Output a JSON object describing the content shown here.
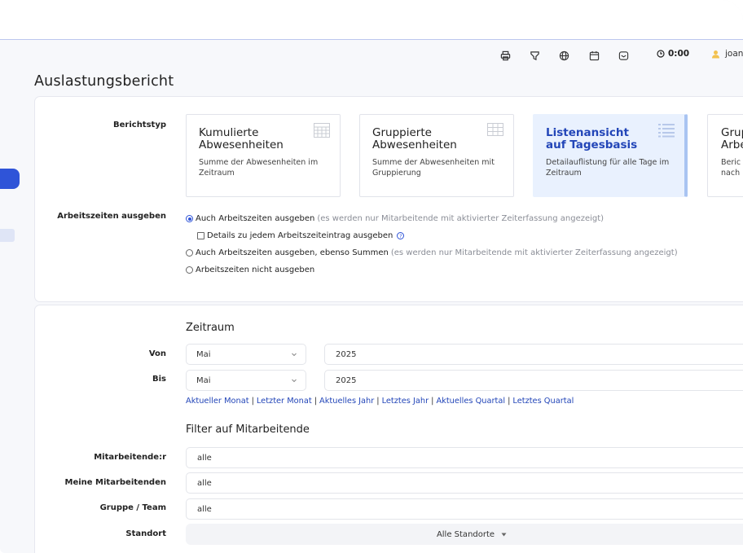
{
  "toolbar": {
    "icons": [
      "print-icon",
      "funnel-icon",
      "globe-icon",
      "calendar-icon",
      "inbox-icon"
    ],
    "clock_label": "0:00",
    "user_name": "joan"
  },
  "page_title": "Auslastungsbericht",
  "report_type": {
    "label": "Berichtstyp",
    "tiles": [
      {
        "title": "Kumulierte Abwesenheiten",
        "desc": "Summe der Abwesenheiten im Zeitraum",
        "icon": "calculator-icon",
        "active": false
      },
      {
        "title": "Gruppierte Abwesenheiten",
        "desc": "Summe der Abwesenheiten mit Gruppierung",
        "icon": "table-icon",
        "active": false
      },
      {
        "title": "Listenansicht auf Tagesbasis",
        "desc": "Detailauflistung für alle Tage im Zeitraum",
        "icon": "list-icon",
        "active": true
      },
      {
        "title": "Grup Arbe",
        "desc": "Beric nach",
        "icon": "",
        "active": false
      }
    ]
  },
  "worktime": {
    "label": "Arbeitszeiten ausgeben",
    "options": [
      {
        "text": "Auch Arbeitszeiten ausgeben",
        "hint": "(es werden nur Mitarbeitende mit aktivierter Zeiterfassung angezeigt)",
        "selected": true
      },
      {
        "text": "Details zu jedem Arbeitszeiteintrag ausgeben",
        "hint": "",
        "checkbox": true
      },
      {
        "text": "Auch Arbeitszeiten ausgeben, ebenso Summen",
        "hint": "(es werden nur Mitarbeitende mit aktivierter Zeiterfassung angezeigt)",
        "selected": false
      },
      {
        "text": "Arbeitszeiten nicht ausgeben",
        "hint": "",
        "selected": false
      }
    ]
  },
  "period": {
    "heading": "Zeitraum",
    "from_label": "Von",
    "to_label": "Bis",
    "from_month": "Mai",
    "from_year": "2025",
    "to_month": "Mai",
    "to_year": "2025",
    "quick_links": [
      "Aktueller Monat",
      "Letzter Monat",
      "Aktuelles Jahr",
      "Letztes Jahr",
      "Aktuelles Quartal",
      "Letztes Quartal"
    ]
  },
  "filter": {
    "heading": "Filter auf Mitarbeitende",
    "rows": [
      {
        "label": "Mitarbeitende:r",
        "value": "alle"
      },
      {
        "label": "Meine Mitarbeitenden",
        "value": "alle"
      },
      {
        "label": "Gruppe / Team",
        "value": "alle"
      }
    ],
    "location_label": "Standort",
    "location_value": "Alle Standorte"
  },
  "colors": {
    "accent": "#2f54d8",
    "link": "#2346b8",
    "active_tile": "#e9f1fe"
  }
}
